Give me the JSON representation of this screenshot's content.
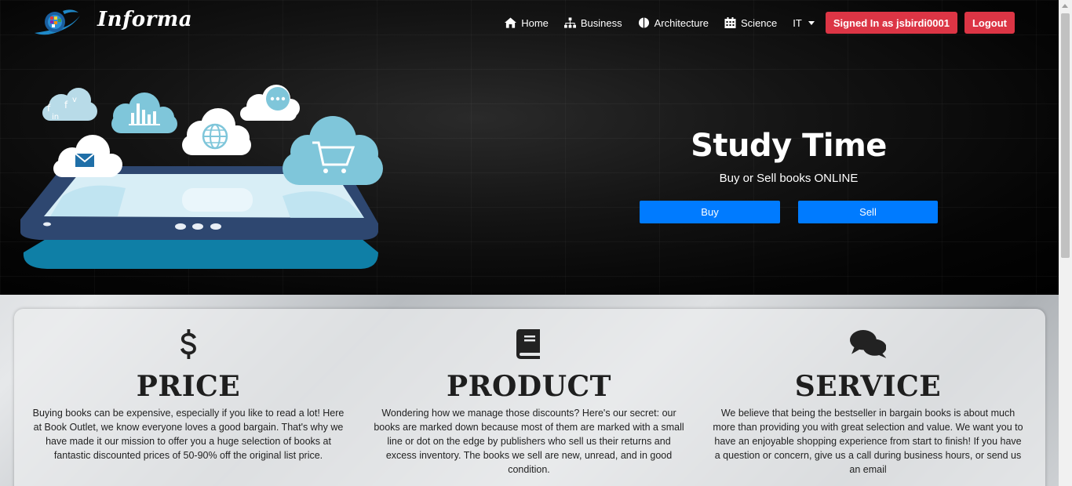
{
  "navbar": {
    "brand_name": "Informa",
    "items": [
      {
        "label": "Home",
        "icon": "home-icon"
      },
      {
        "label": "Business",
        "icon": "sitemap-icon"
      },
      {
        "label": "Architecture",
        "icon": "brain-icon"
      },
      {
        "label": "Science",
        "icon": "calendar-icon"
      },
      {
        "label": "IT",
        "icon": "caret-down-icon"
      }
    ],
    "signed_in_label": "Signed In as jsbirdi0001",
    "logout_label": "Logout",
    "accent_color": "#dc3545"
  },
  "hero": {
    "title": "Study Time",
    "subtitle": "Buy or Sell books ONLINE",
    "buy_label": "Buy",
    "sell_label": "Sell",
    "button_color": "#007bff"
  },
  "features": [
    {
      "icon": "dollar-icon",
      "title": "PRICE",
      "text": "Buying books can be expensive, especially if you like to read a lot! Here at Book Outlet, we know everyone loves a good bargain. That's why we have made it our mission to offer you a huge selection of books at fantastic discounted prices of 50-90% off the original list price."
    },
    {
      "icon": "book-icon",
      "title": "PRODUCT",
      "text": "Wondering how we manage those discounts? Here's our secret: our books are marked down because most of them are marked with a small line or dot on the edge by publishers who sell us their returns and excess inventory. The books we sell are new, unread, and in good condition."
    },
    {
      "icon": "comments-icon",
      "title": "SERVICE",
      "text": "We believe that being the bestseller in bargain books is about much more than providing you with great selection and value. We want you to have an enjoyable shopping experience from start to finish! If you have a question or concern, give us a call during business hours, or send us an email"
    }
  ]
}
